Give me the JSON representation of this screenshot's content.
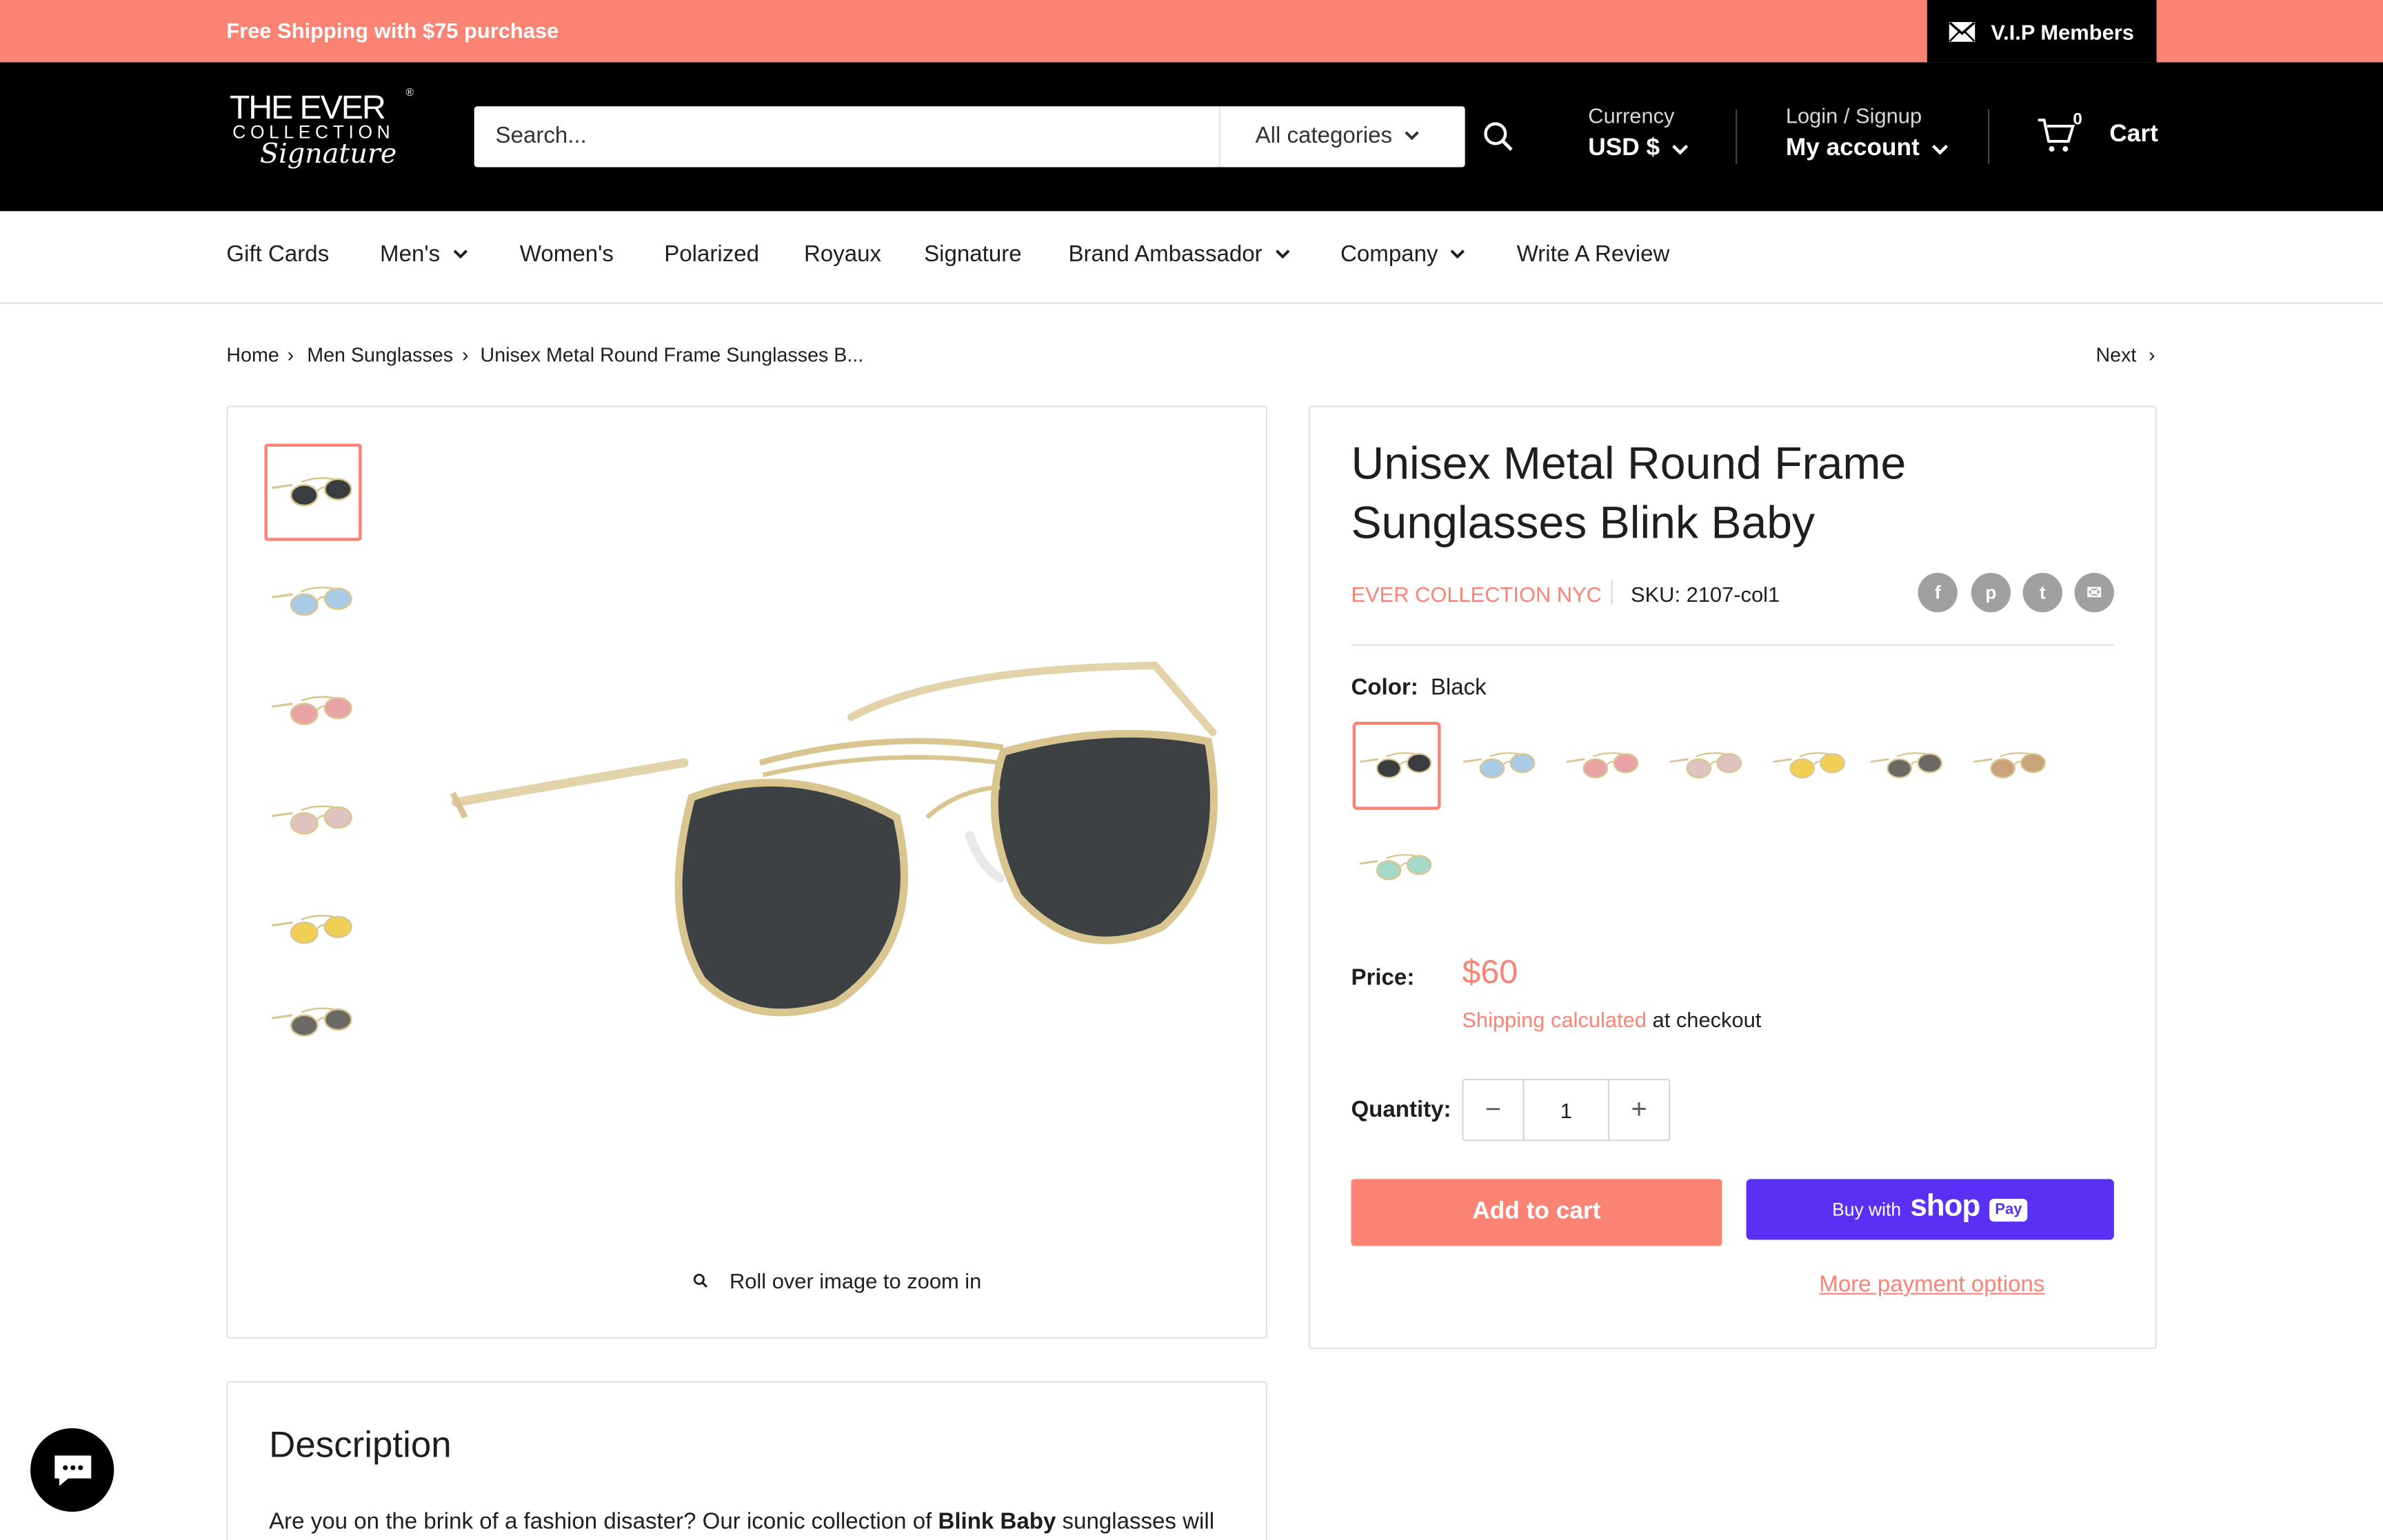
{
  "announcement": {
    "text": "Free Shipping with $75 purchase",
    "vip_label": "V.I.P Members"
  },
  "header": {
    "logo": {
      "line1": "THE EVER",
      "line2": "COLLECTION",
      "line3": "Signature",
      "reg": "®"
    },
    "search": {
      "placeholder": "Search...",
      "category": "All categories"
    },
    "currency": {
      "label": "Currency",
      "value": "USD $"
    },
    "account": {
      "label": "Login / Signup",
      "value": "My account"
    },
    "cart": {
      "count": "0",
      "label": "Cart"
    }
  },
  "nav": {
    "items": [
      "Gift Cards",
      "Men's",
      "Women's",
      "Polarized",
      "Royaux",
      "Signature",
      "Brand Ambassador",
      "Company",
      "Write A Review"
    ]
  },
  "breadcrumb": {
    "items": [
      "Home",
      "Men Sunglasses",
      "Unisex Metal Round Frame Sunglasses B..."
    ],
    "next": "Next"
  },
  "gallery": {
    "zoom_hint": "Roll over image to zoom in",
    "thumb_colors": [
      "#3a3d3f",
      "#a9cbe8",
      "#e8a3a5",
      "#dfc3c1",
      "#f1cf55",
      "#6c6a67"
    ]
  },
  "product": {
    "title": "Unisex Metal Round Frame Sunglasses Blink Baby",
    "vendor": "EVER COLLECTION NYC",
    "sku": "SKU: 2107-col1",
    "social": [
      "f",
      "p",
      "t",
      "✉"
    ],
    "color_label": "Color:",
    "color_value": "Black",
    "swatch_colors": [
      "#3a3d3f",
      "#a9cbe8",
      "#e8a3a5",
      "#dfc3c1",
      "#f1cf55",
      "#6c6a67",
      "#c9a47a",
      "#a6d9c9"
    ],
    "price_label": "Price:",
    "price": "$60",
    "shipping_link": "Shipping calculated",
    "shipping_rest": " at checkout",
    "quantity_label": "Quantity:",
    "quantity": "1",
    "add_to_cart": "Add to cart",
    "buy_with": "Buy with",
    "shop": "shop",
    "pay": "Pay",
    "more_payment": "More payment options"
  },
  "description": {
    "title": "Description",
    "text_before": "Are you on the brink of a fashion disaster? Our iconic collection of ",
    "text_bold": "Blink Baby",
    "text_after": " sunglasses will"
  },
  "colors": {
    "accent": "#fa8373",
    "header_bg": "#000000",
    "shoppay": "#5a31f4"
  }
}
